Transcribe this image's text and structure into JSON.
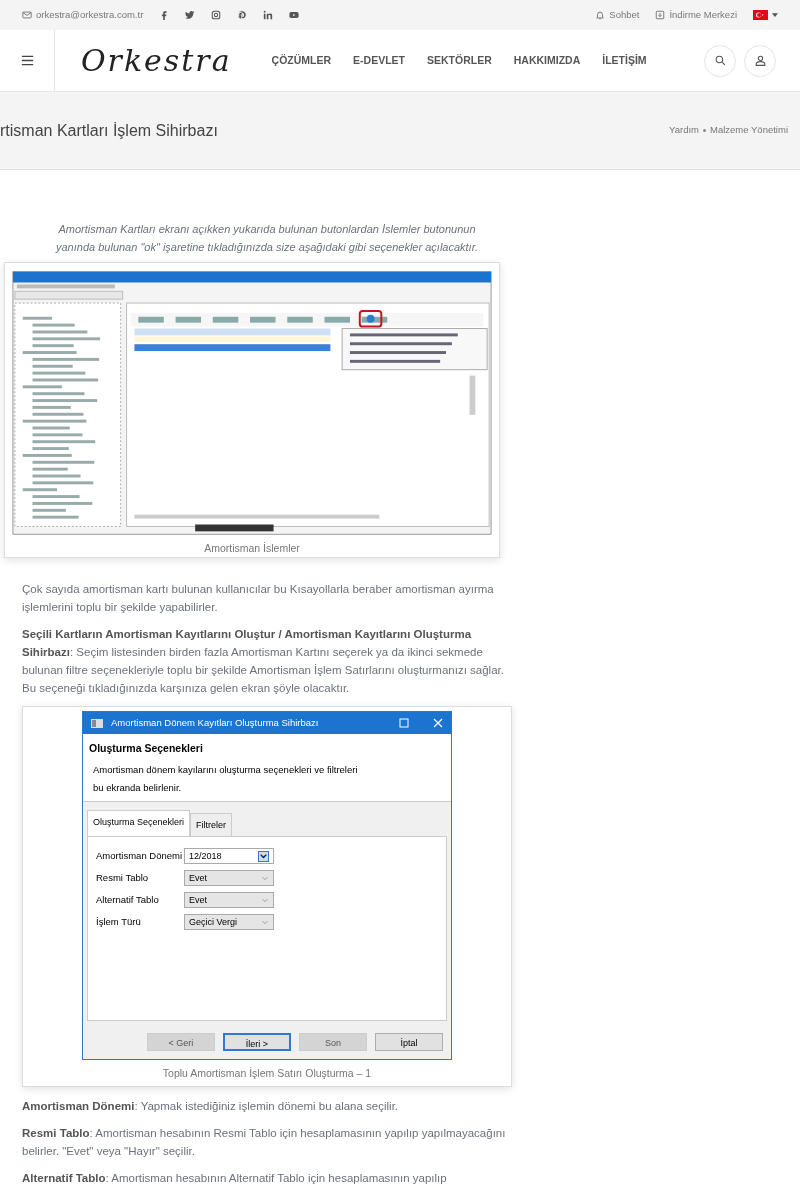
{
  "topbar": {
    "email": "orkestra@orkestra.com.tr",
    "links": [
      {
        "kind": "chat",
        "label": "Sohbet"
      },
      {
        "kind": "download",
        "label": "İndirme Merkezi"
      }
    ]
  },
  "navbar": {
    "logo": "Orkestra",
    "menu": [
      "ÇÖZÜMLER",
      "E-DEVLET",
      "SEKTÖRLER",
      "HAKKIMIZDA",
      "İLETİŞİM"
    ]
  },
  "page_header": {
    "title": "rtisman Kartları İşlem Sihirbazı",
    "breadcrumb": [
      "Yardım",
      "Malzeme Yönetimi"
    ]
  },
  "intro": "Amortisman Kartları ekranı açıkken yukarıda bulunan butonlardan İslemler butonunun yanında bulunan \"ok\" işaretine tıkladığınızda size aşağıdaki gibi seçenekler açılacaktır.",
  "figure_1": {
    "caption": "Amortisman İslemler"
  },
  "paragraphs": [
    "Çok sayıda amortisman kartı bulunan kullanıcılar bu Kısayollarla beraber amortisman ayırma işlemlerini toplu bir şekilde yapabilirler.",
    "**Seçili Kartların Amortisman Kayıtlarını Oluştur / Amortisman Kayıtlarını Oluşturma Sihirbazı**: Seçim listesinden birden fazla Amortisman Kartını seçerek ya da ikinci sekmede bulunan filtre seçenekleriyle toplu bir şekilde Amortisman İşlem Satırlarını oluşturmanızı sağlar. Bu seçeneği tıkladığınızda karşınıza gelen ekran şöyle olacaktır."
  ],
  "figure_2": {
    "caption": "Toplu Amortisman İşlem Satırı Oluşturma – 1",
    "dialog": {
      "title": "Amortisman Dönem Kayıtları Oluşturma Sihirbazı",
      "heading": "Oluşturma Seçenekleri",
      "description": "Amortisman dönem kayılarını oluşturma seçenekleri ve filtreleri bu ekranda belirlenir.",
      "tabs": [
        {
          "label": "Oluşturma Seçenekleri",
          "selected": true
        },
        {
          "label": "Filtreler",
          "selected": false
        }
      ],
      "fields": [
        {
          "label": "Amortisman Dönemi",
          "value": "12/2018",
          "kind": "date"
        },
        {
          "label": "Resmi Tablo",
          "value": "Evet",
          "kind": "select"
        },
        {
          "label": "Alternatif Tablo",
          "value": "Evet",
          "kind": "select"
        },
        {
          "label": "İşlem Türü",
          "value": "Geçici Vergi",
          "kind": "select"
        }
      ],
      "buttons": [
        {
          "label": "< Geri",
          "disabled": true,
          "focused": false
        },
        {
          "label": "İleri >",
          "disabled": false,
          "focused": true
        },
        {
          "label": "Son",
          "disabled": true,
          "focused": false
        },
        {
          "label": "İptal",
          "disabled": false,
          "focused": false
        }
      ]
    }
  },
  "definitions": [
    "**Amortisman Dönemi**: Yapmak istediğiniz işlemin dönemi bu alana seçilir.",
    "**Resmi Tablo**: Amortisman hesabının Resmi Tablo için hesaplamasının yapılıp yapılmayacağını belirler. \"Evet\" veya \"Hayır\" seçilir.",
    "**Alternatif Tablo**: Amortisman hesabının Alternatif Tablo için hesaplamasının yapılıp"
  ]
}
